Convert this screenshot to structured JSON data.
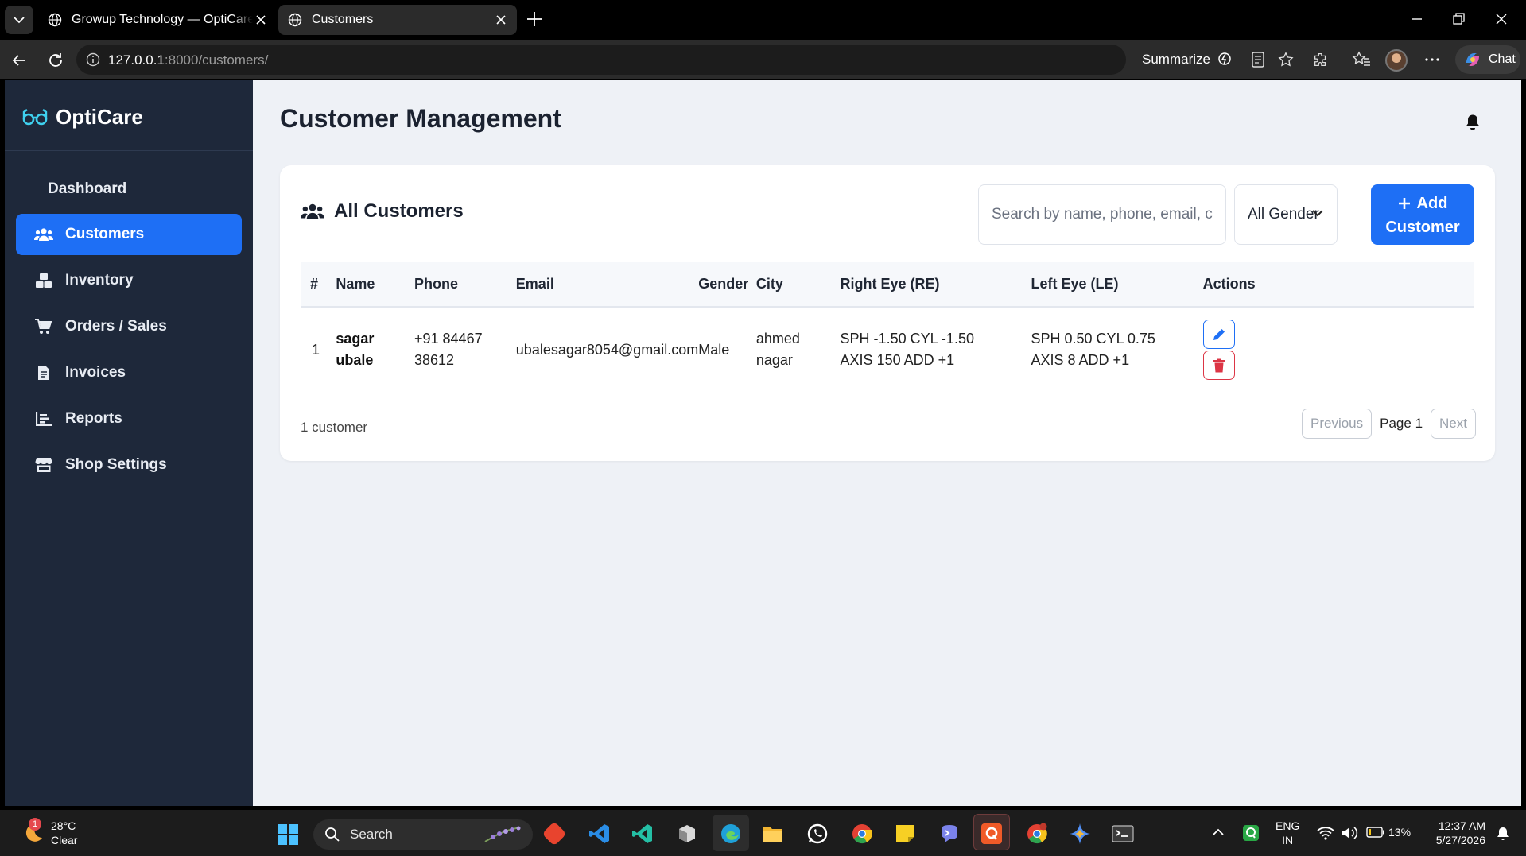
{
  "browser": {
    "tabs": [
      {
        "title": "Growup Technology — OptiCare Pro",
        "active": false
      },
      {
        "title": "Customers",
        "active": true
      }
    ],
    "url_host": "127.0.0.1",
    "url_rest": ":8000/customers/",
    "summarize_label": "Summarize",
    "chat_label": "Chat"
  },
  "app": {
    "brand": "OptiCare",
    "nav": [
      {
        "label": "Dashboard",
        "icon": "none"
      },
      {
        "label": "Customers",
        "icon": "users-icon",
        "active": true
      },
      {
        "label": "Inventory",
        "icon": "boxes-icon"
      },
      {
        "label": "Orders / Sales",
        "icon": "cart-icon"
      },
      {
        "label": "Invoices",
        "icon": "invoice-icon"
      },
      {
        "label": "Reports",
        "icon": "chart-icon"
      },
      {
        "label": "Shop Settings",
        "icon": "store-icon"
      }
    ],
    "page_title": "Customer Management",
    "card_title": "All Customers",
    "search_placeholder": "Search by name, phone, email, city",
    "gender_filter": "All Gender",
    "add_button": "+ Add Customer",
    "add_button_l1": "Add",
    "add_button_l2": "Customer",
    "columns": [
      "#",
      "Name",
      "Phone",
      "Email",
      "Gender",
      "City",
      "Right Eye (RE)",
      "Left Eye (LE)",
      "Actions"
    ],
    "rows": [
      {
        "num": "1",
        "name": "sagar ubale",
        "phone": "+91 84467 38612",
        "email": "ubalesagar8054@gmail.com",
        "gender": "Male",
        "city": "ahmed nagar",
        "re": "SPH -1.50 CYL -1.50 AXIS 150 ADD +1",
        "le": "SPH 0.50 CYL 0.75 AXIS 8 ADD +1"
      }
    ],
    "count_text": "1 customer",
    "pagination": {
      "prev": "Previous",
      "page": "Page 1",
      "next": "Next"
    },
    "colors": {
      "sidebar": "#1e283a",
      "accent": "#1e6ff5",
      "danger": "#dc3545",
      "bg": "#eef1f6"
    }
  },
  "taskbar": {
    "weather_temp": "28°C",
    "weather_desc": "Clear",
    "weather_badge": "1",
    "search_label": "Search",
    "lang_1": "ENG",
    "lang_2": "IN",
    "battery": "13%",
    "time": "12:37 AM",
    "date": "5/27/2026"
  }
}
